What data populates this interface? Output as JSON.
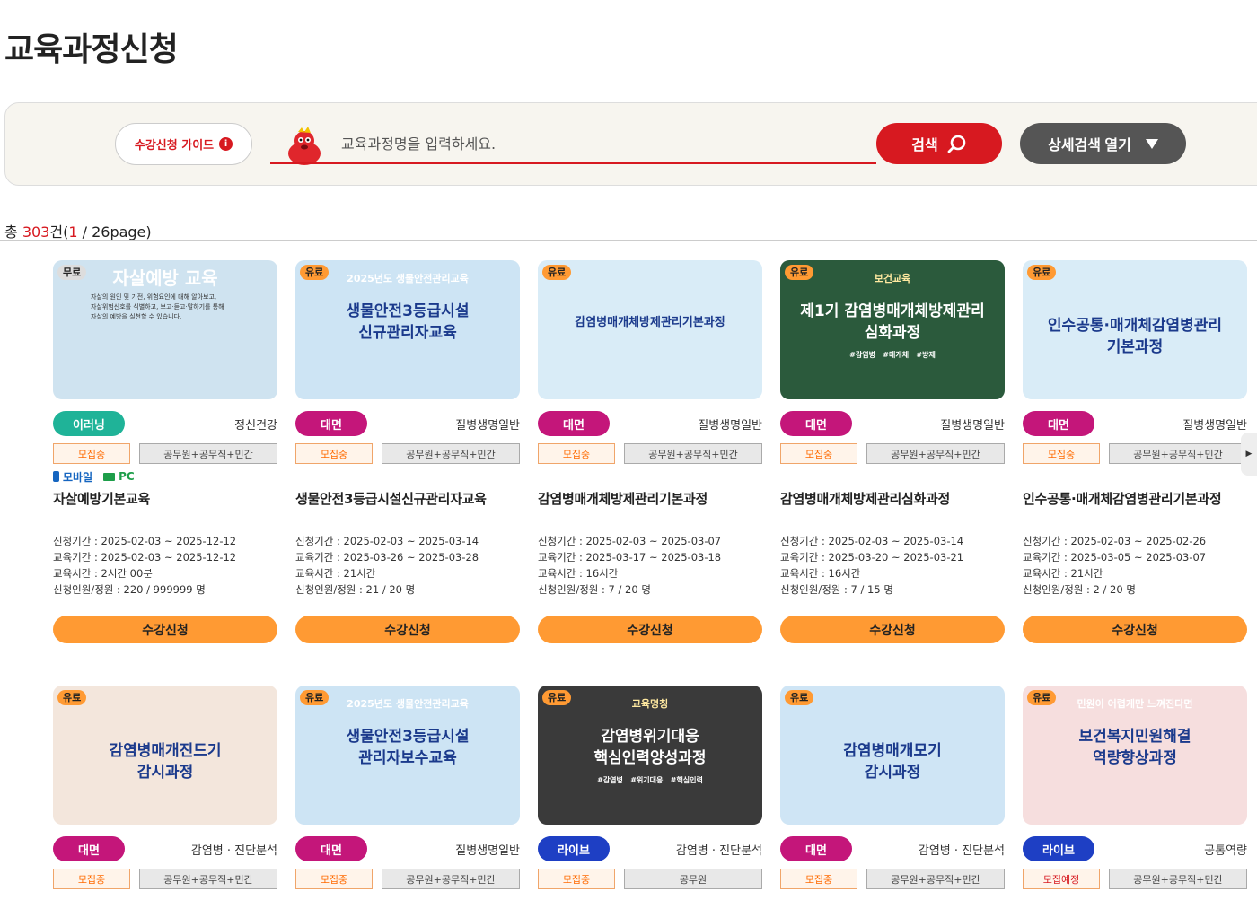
{
  "page": {
    "title": "교육과정신청"
  },
  "search": {
    "guide_label": "수강신청 가이드",
    "placeholder": "교육과정명을 입력하세요.",
    "search_label": "검색",
    "detail_label": "상세검색 열기"
  },
  "results": {
    "prefix": "총 ",
    "count": "303",
    "unit": "건(",
    "page": "1",
    "page_suffix": " / 26page)"
  },
  "labels": {
    "apply": "수강신청",
    "mobile": "모바일",
    "pc": "PC",
    "req_period": "신청기간 : ",
    "edu_period": "교육기간 : ",
    "edu_time": "교육시간 : ",
    "enroll": "신청인원/정원 : "
  },
  "cards": [
    {
      "price": "무료",
      "thumb": {
        "title": "자살예방 교육",
        "lines": [
          "자살의 원인 및 기전, 위험요인에 대해 알아보고,",
          "자살위험신호를 식별하고, 보고·듣고·말하기를 통해",
          "자살의 예방을 실천할 수 있습니다."
        ],
        "bg": "#cfe3f0"
      },
      "type": "이러닝",
      "type_color": "#1fb398",
      "category": "정신건강",
      "status": "모집중",
      "target": "공무원+공무직+민간",
      "devices": true,
      "title": "자살예방기본교육",
      "req_period": "2025-02-03 ~ 2025-12-12",
      "edu_period": "2025-02-03 ~ 2025-12-12",
      "edu_time": "2시간 00분",
      "enroll": "220 / 999999 명"
    },
    {
      "price": "유료",
      "thumb": {
        "banner": "2025년도 생물안전관리교육",
        "title": "생물안전3등급시설",
        "title2": "신규관리자교육",
        "bg": "#cde4f4"
      },
      "type": "대면",
      "type_color": "#c4167a",
      "category": "질병생명일반",
      "status": "모집중",
      "target": "공무원+공무직+민간",
      "devices": false,
      "title": "생물안전3등급시설신규관리자교육",
      "req_period": "2025-02-03 ~ 2025-03-14",
      "edu_period": "2025-03-26 ~ 2025-03-28",
      "edu_time": "21시간",
      "enroll": "21 / 20 명"
    },
    {
      "price": "유료",
      "thumb": {
        "title": "감염병매개체방제관리기본과정",
        "bg": "#d9ecf7"
      },
      "type": "대면",
      "type_color": "#c4167a",
      "category": "질병생명일반",
      "status": "모집중",
      "target": "공무원+공무직+민간",
      "devices": false,
      "title": "감염병매개체방제관리기본과정",
      "req_period": "2025-02-03 ~ 2025-03-07",
      "edu_period": "2025-03-17 ~ 2025-03-18",
      "edu_time": "16시간",
      "enroll": "7 / 20 명"
    },
    {
      "price": "유료",
      "thumb": {
        "banner": "보건교육",
        "title": "제1기 감염병매개체방제관리",
        "title2": "심화과정",
        "tags": "#감염병   #매개체   #방제",
        "bg": "#2b5a3c"
      },
      "type": "대면",
      "type_color": "#c4167a",
      "category": "질병생명일반",
      "status": "모집중",
      "target": "공무원+공무직+민간",
      "devices": false,
      "title": "감염병매개체방제관리심화과정",
      "req_period": "2025-02-03 ~ 2025-03-14",
      "edu_period": "2025-03-20 ~ 2025-03-21",
      "edu_time": "16시간",
      "enroll": "7 / 15 명"
    },
    {
      "price": "유료",
      "thumb": {
        "title": "인수공통·매개체감염병관리",
        "title2": "기본과정",
        "bg": "#d9ecf7"
      },
      "type": "대면",
      "type_color": "#c4167a",
      "category": "질병생명일반",
      "status": "모집중",
      "target": "공무원+공무직+민간",
      "devices": false,
      "title": "인수공통·매개체감염병관리기본과정",
      "req_period": "2025-02-03 ~ 2025-02-26",
      "edu_period": "2025-03-05 ~ 2025-03-07",
      "edu_time": "21시간",
      "enroll": "2 / 20 명"
    },
    {
      "price": "유료",
      "thumb": {
        "title": "감염병매개진드기",
        "title2": "감시과정",
        "bg": "#f3e6dc"
      },
      "type": "대면",
      "type_color": "#c4167a",
      "category": "감염병 · 진단분석",
      "status": "모집중",
      "target": "공무원+공무직+민간"
    },
    {
      "price": "유료",
      "thumb": {
        "banner": "2025년도 생물안전관리교육",
        "title": "생물안전3등급시설",
        "title2": "관리자보수교육",
        "bg": "#cde4f4"
      },
      "type": "대면",
      "type_color": "#c4167a",
      "category": "질병생명일반",
      "status": "모집중",
      "target": "공무원+공무직+민간"
    },
    {
      "price": "유료",
      "thumb": {
        "banner": "교육명칭",
        "title": "감염병위기대응",
        "title2": "핵심인력양성과정",
        "tags": "#감염병   #위기대응   #핵심인력",
        "bg": "#3a3a3a"
      },
      "type": "라이브",
      "type_color": "#1e3fc4",
      "category": "감염병 · 진단분석",
      "status": "모집중",
      "target": "공무원"
    },
    {
      "price": "유료",
      "thumb": {
        "title": "감염병매개모기",
        "title2": "감시과정",
        "bg": "#cfe5f5"
      },
      "type": "대면",
      "type_color": "#c4167a",
      "category": "감염병 · 진단분석",
      "status": "모집중",
      "target": "공무원+공무직+민간"
    },
    {
      "price": "유료",
      "thumb": {
        "banner": "민원이 어렵게만 느껴진다면",
        "title": "보건복지민원해결",
        "title2": "역량향상과정",
        "bg": "#f6dede"
      },
      "type": "라이브",
      "type_color": "#1e3fc4",
      "category": "공통역량",
      "status": "모집예정",
      "target": "공무원+공무직+민간"
    }
  ]
}
